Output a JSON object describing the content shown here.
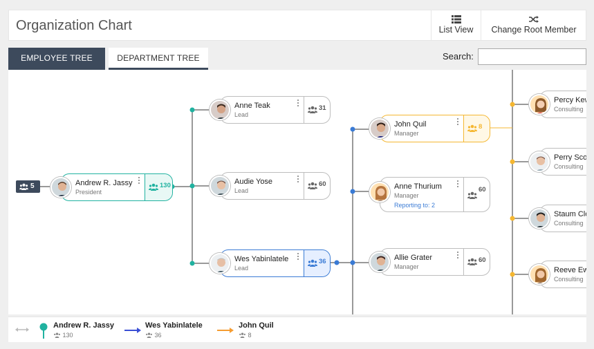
{
  "header": {
    "title": "Organization Chart",
    "list_view": "List View",
    "change_root": "Change Root Member"
  },
  "tabs": {
    "employee": "EMPLOYEE TREE",
    "department": "DEPARTMENT TREE"
  },
  "search": {
    "label": "Search:",
    "value": ""
  },
  "root_count": "5",
  "nodes": {
    "andrew": {
      "name": "Andrew R. Jassy",
      "role": "President",
      "count": "130"
    },
    "anne_teak": {
      "name": "Anne Teak",
      "role": "Lead",
      "count": "31"
    },
    "audie": {
      "name": "Audie Yose",
      "role": "Lead",
      "count": "60"
    },
    "wes": {
      "name": "Wes Yabinlatele",
      "role": "Lead",
      "count": "36"
    },
    "john": {
      "name": "John Quil",
      "role": "Manager",
      "count": "8"
    },
    "anne_thurium": {
      "name": "Anne Thurium",
      "role": "Manager",
      "count": "60",
      "reporting": "Reporting to: 2"
    },
    "allie": {
      "name": "Allie Grater",
      "role": "Manager",
      "count": "60"
    },
    "percy": {
      "name": "Percy Kewshun",
      "role": "Consulting"
    },
    "perry": {
      "name": "Perry Scope",
      "role": "Consulting"
    },
    "staum": {
      "name": "Staum Clotes",
      "role": "Consulting"
    },
    "reeve": {
      "name": "Reeve Ewer",
      "role": "Consulting"
    }
  },
  "breadcrumb": [
    {
      "name": "Andrew R. Jassy",
      "count": "130"
    },
    {
      "name": "Wes Yabinlatele",
      "count": "36"
    },
    {
      "name": "John Quil",
      "count": "8"
    }
  ],
  "colors": {
    "teal": "#20b2a0",
    "blue": "#3a7bd5",
    "yellow": "#f5b731",
    "dark": "#3d4a5c"
  }
}
